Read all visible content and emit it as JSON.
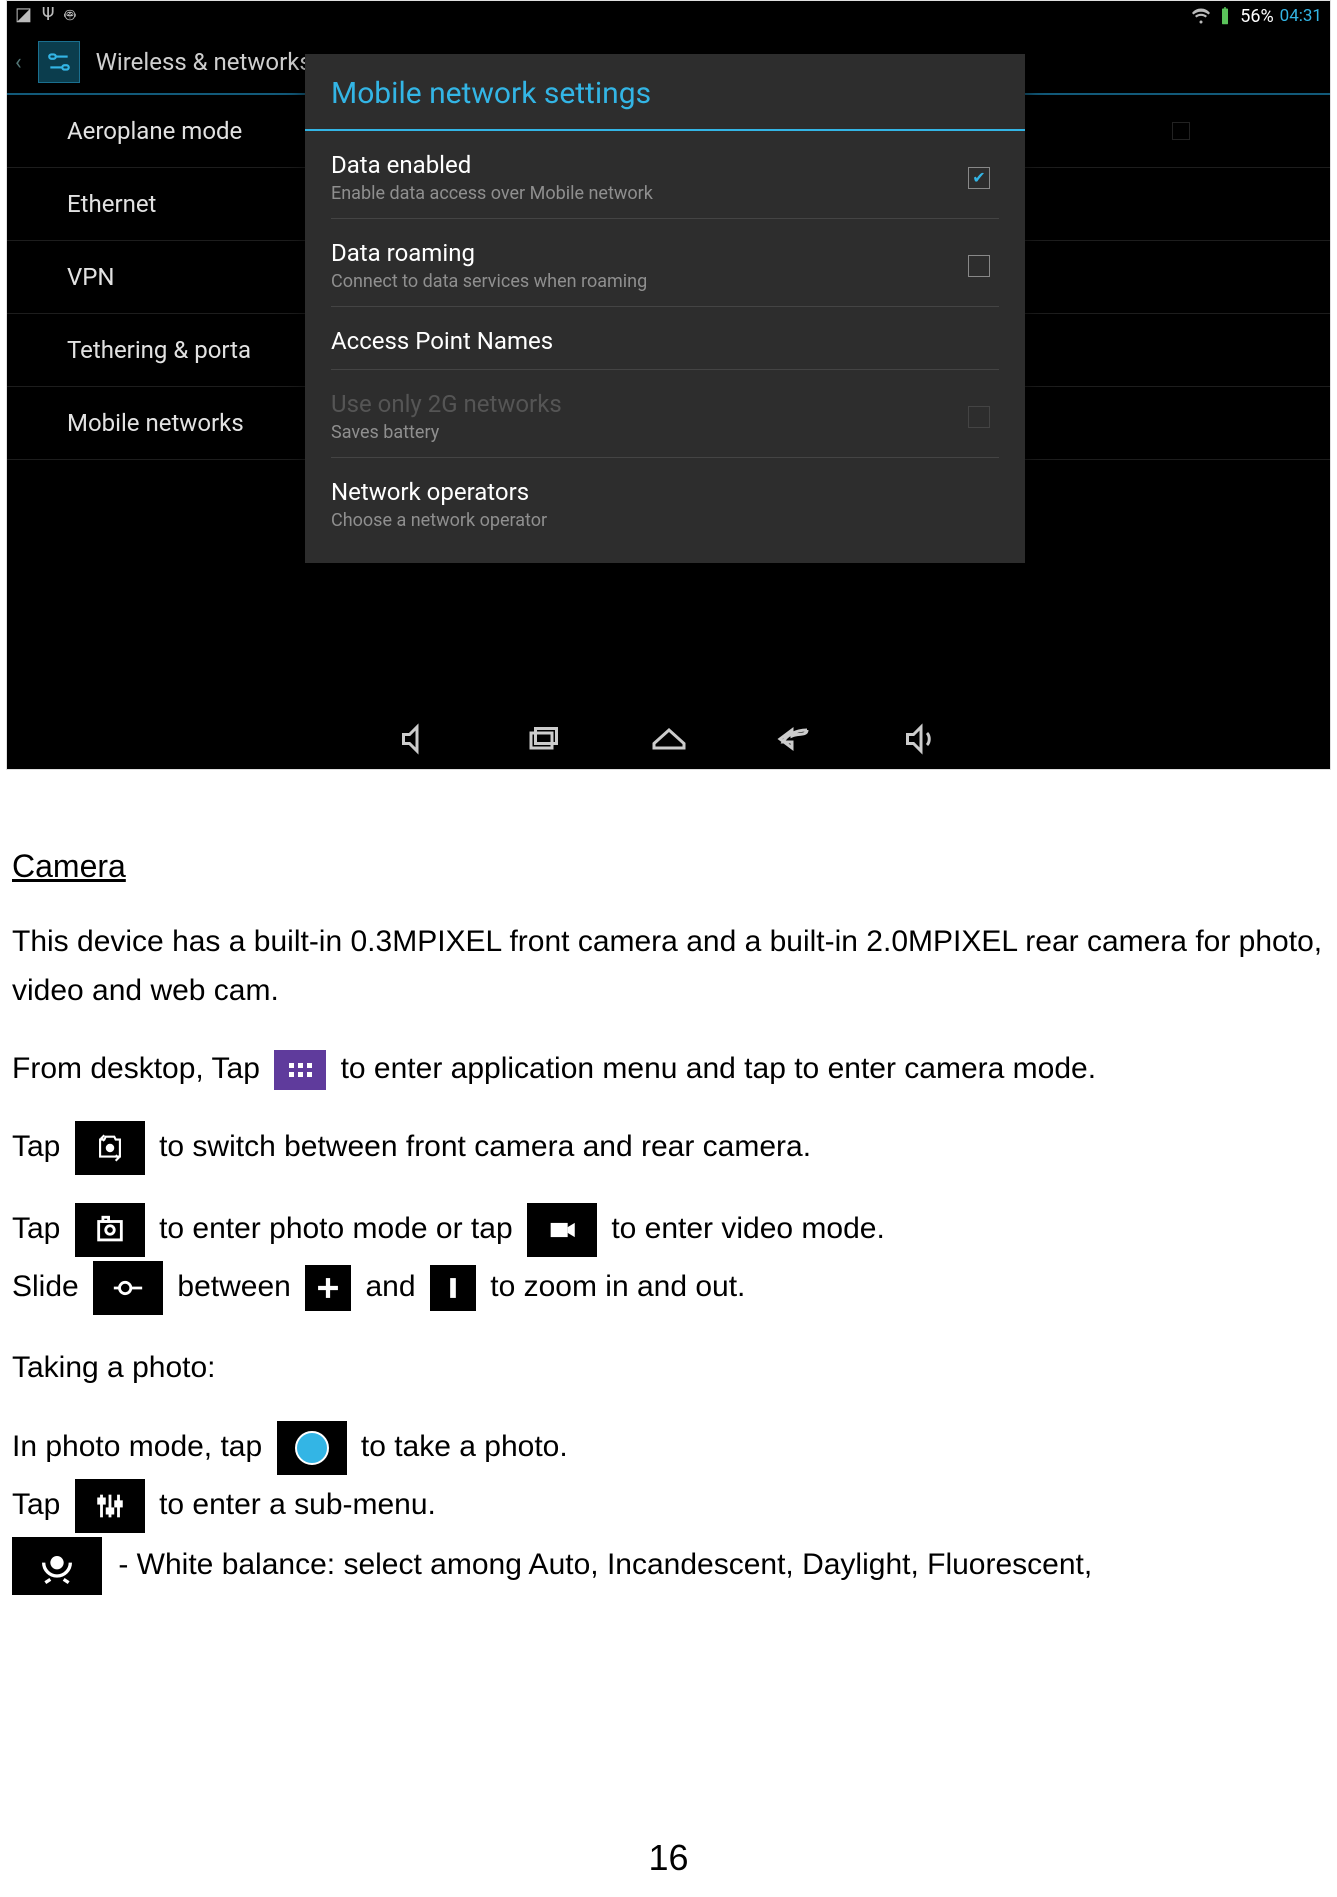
{
  "statusbar": {
    "battery_pct": "56%",
    "clock": "04:31"
  },
  "settings": {
    "header_title": "Wireless & networks",
    "items": [
      "Aeroplane mode",
      "Ethernet",
      "VPN",
      "Tethering & porta",
      "Mobile networks"
    ]
  },
  "dialog": {
    "title": "Mobile network settings",
    "rows": [
      {
        "title": "Data enabled",
        "sub": "Enable data access over Mobile network",
        "checkbox": "checked"
      },
      {
        "title": "Data roaming",
        "sub": "Connect to data services when roaming",
        "checkbox": "empty"
      },
      {
        "title": "Access Point Names",
        "sub": "",
        "checkbox": "none"
      },
      {
        "title": "Use only 2G networks",
        "sub": "Saves battery",
        "checkbox": "disabled",
        "disabled": true
      },
      {
        "title": "Network operators",
        "sub": "Choose a network operator",
        "checkbox": "none"
      }
    ]
  },
  "doc": {
    "heading": "Camera",
    "p1": "This device has a built-in 0.3MPIXEL front camera and a built-in 2.0MPIXEL rear camera for photo, video and web cam.",
    "p2_a": "From desktop, Tap ",
    "p2_b": "  to enter application menu and tap          to enter camera mode.",
    "p3_a": "Tap ",
    "p3_b": " to switch between front camera and rear camera.",
    "p4_a": "Tap ",
    "p4_b": " to enter photo mode or tap ",
    "p4_c": " to enter video mode.",
    "p5_a": "Slide ",
    "p5_b": " between ",
    "p5_c": " and ",
    "p5_d": " to zoom in and out.",
    "p6": "Taking a photo:",
    "p7_a": "In photo mode, tap ",
    "p7_b": " to take a photo.",
    "p8_a": "Tap ",
    "p8_b": " to enter a sub-menu.",
    "p9": " - White balance:   select among Auto, Incandescent, Daylight, Fluorescent,",
    "page_number": "16"
  }
}
